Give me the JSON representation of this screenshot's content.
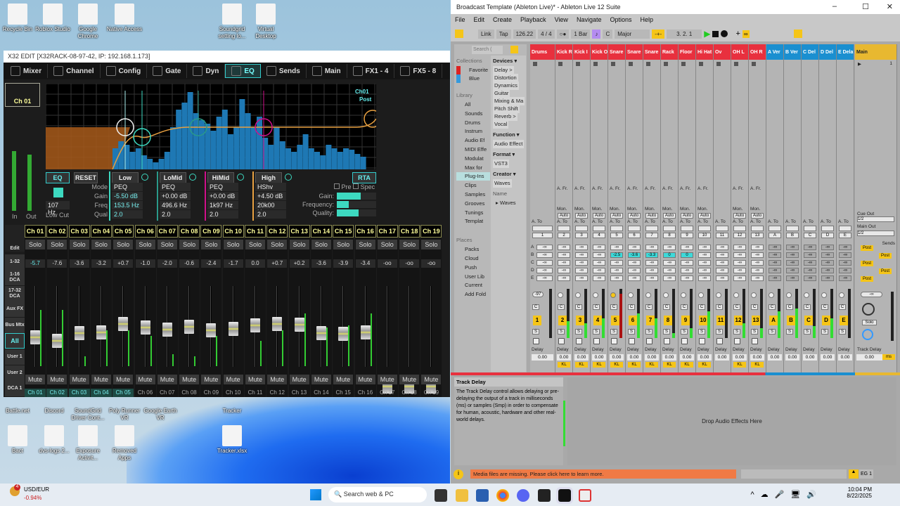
{
  "desktop": {
    "top_icons": [
      {
        "label": "Recycle Bin"
      },
      {
        "label": "Roblox Studio"
      },
      {
        "label": "Google Chrome"
      },
      {
        "label": "Native Access"
      },
      {
        "label": "Soundgrid setting lo..."
      },
      {
        "label": "Virtual Desktop"
      }
    ],
    "row2_icons": [
      {
        "label": "Battle.net"
      },
      {
        "label": "Discord"
      },
      {
        "label": "SoundGrid Driver Cont..."
      },
      {
        "label": "Poly Runner VR"
      },
      {
        "label": "Google Earth VR"
      },
      {
        "label": "Tracker"
      }
    ],
    "row3_icons": [
      {
        "label": "Bact"
      },
      {
        "label": "dvs-logs 2..."
      },
      {
        "label": "Exposure Activit..."
      },
      {
        "label": "Removed Apps"
      },
      {
        "label": "Tracker.xlsx"
      }
    ]
  },
  "x32": {
    "title": "X32 EDIT [X32RACK-08-97-42, IP: 192.168.1.173]",
    "tabs": [
      "Mixer",
      "Channel",
      "Config",
      "Gate",
      "Dyn",
      "EQ",
      "Sends",
      "Main",
      "FX1 - 4",
      "FX5 - 8"
    ],
    "active_tab": "EQ",
    "channel": "Ch 01",
    "meter_labels": {
      "in": "In",
      "out": "Out"
    },
    "graph_labels": {
      "ch": "Ch01",
      "post": "Post"
    },
    "eq_button": "EQ",
    "reset_button": "RESET",
    "rta_button": "RTA",
    "low_cut": {
      "freq": "107 Hz",
      "label": "Low Cut"
    },
    "row_labels": [
      "Mode",
      "Gain",
      "Freq",
      "Qual"
    ],
    "bands": [
      {
        "name": "Low",
        "mode": "PEQ",
        "gain": "-5.50 dB",
        "freq": "153.5 Hz",
        "q": "2.0",
        "color": "#3dd9c0"
      },
      {
        "name": "LoMid",
        "mode": "PEQ",
        "gain": "+0.00 dB",
        "freq": "496.6 Hz",
        "q": "2.0",
        "color": "#2a9a8a"
      },
      {
        "name": "HiMid",
        "mode": "PEQ",
        "gain": "+0.00 dB",
        "freq": "1k97 Hz",
        "q": "2.0",
        "color": "#d0108a"
      },
      {
        "name": "High",
        "mode": "HShv",
        "gain": "+4.50 dB",
        "freq": "20k00 Hz",
        "q": "2.0",
        "color": "#e8a040"
      }
    ],
    "rta": {
      "pre": "Pre",
      "spec": "Spec",
      "gain_label": "Gain:",
      "freq_label": "Frequency:",
      "q_label": "Quality:",
      "gain": 0.6,
      "freq": 0.3,
      "q": 0.55
    },
    "nav": [
      "Edit",
      "1-32",
      "1-16 DCA",
      "17-32 DCA",
      "Aux FX",
      "Bus Mtx",
      "All",
      "User 1",
      "User 2",
      "DCA 1"
    ],
    "solo_label": "Solo",
    "mute_label": "Mute",
    "channels": [
      {
        "name": "Ch 01",
        "value": "-5.7",
        "db": -5.7,
        "meter": 0.55
      },
      {
        "name": "Ch 02",
        "value": "-7.6",
        "db": -7.6,
        "meter": 0.55
      },
      {
        "name": "Ch 03",
        "value": "-3.6",
        "db": -3.6,
        "meter": 0.1
      },
      {
        "name": "Ch 04",
        "value": "-3.2",
        "db": -3.2,
        "meter": 0.35
      },
      {
        "name": "Ch 05",
        "value": "+0.7",
        "db": 0.7,
        "meter": 0.35
      },
      {
        "name": "Ch 06",
        "value": "-1.0",
        "db": -1.0,
        "meter": 0.3
      },
      {
        "name": "Ch 07",
        "value": "-2.0",
        "db": -2.0,
        "meter": 0.12
      },
      {
        "name": "Ch 08",
        "value": "-0.6",
        "db": -0.6,
        "meter": 0.1
      },
      {
        "name": "Ch 09",
        "value": "-2.4",
        "db": -2.4,
        "meter": 0.3
      },
      {
        "name": "Ch 10",
        "value": "-1.7",
        "db": -1.7,
        "meter": 0
      },
      {
        "name": "Ch 11",
        "value": "0.0",
        "db": 0,
        "meter": 0.25
      },
      {
        "name": "Ch 12",
        "value": "+0.7",
        "db": 0.7,
        "meter": 0.35
      },
      {
        "name": "Ch 13",
        "value": "+0.2",
        "db": 0.2,
        "meter": 0.52
      },
      {
        "name": "Ch 14",
        "value": "-3.6",
        "db": -3.6,
        "meter": 0.38
      },
      {
        "name": "Ch 15",
        "value": "-3.9",
        "db": -3.9,
        "meter": 0.4
      },
      {
        "name": "Ch 16",
        "value": "-3.4",
        "db": -3.4,
        "meter": 0.52
      },
      {
        "name": "Ch 17",
        "value": "-oo",
        "db": -90,
        "meter": 0
      },
      {
        "name": "Ch 18",
        "value": "-oo",
        "db": -90,
        "meter": 0
      },
      {
        "name": "Ch 19",
        "value": "-oo",
        "db": -90,
        "meter": 0
      }
    ]
  },
  "ableton": {
    "title": "Broadcast Template (Ableton Live)* - Ableton Live 12 Suite",
    "menu": [
      "File",
      "Edit",
      "Create",
      "Playback",
      "View",
      "Navigate",
      "Options",
      "Help"
    ],
    "toolbar": {
      "link": "Link",
      "tap": "Tap",
      "tempo": "126.22",
      "signature": "4 / 4",
      "quantize": "1 Bar",
      "key": "C",
      "scale": "Major",
      "position": "3.  2.  1"
    },
    "browser": {
      "search_placeholder": "Search (",
      "collections_title": "Collections",
      "collections": [
        "Favorite",
        "Blue"
      ],
      "library_title": "Library",
      "library": [
        "All",
        "Sounds",
        "Drums",
        "Instrum",
        "Audio Ef",
        "MIDI Effe",
        "Modulat",
        "Max for",
        "Plug-Ins",
        "Clips",
        "Samples",
        "Grooves",
        "Tunings",
        "Templat"
      ],
      "places_title": "Places",
      "places": [
        "Packs",
        "Cloud",
        "Push",
        "User Lib",
        "Current",
        "Add Fold"
      ],
      "filters": [
        {
          "title": "Devices ▾",
          "items": [
            "Delay >",
            "Distortion",
            "Dynamics",
            "Guitar",
            "Mixing & Ma",
            "Pitch Shift",
            "Reverb >",
            "Vocal"
          ]
        },
        {
          "title": "Function ▾",
          "items": [
            "Audio Effect"
          ]
        },
        {
          "title": "Format ▾",
          "items": [
            "VST3"
          ]
        },
        {
          "title": "Creator ▾",
          "items": [
            "Waves"
          ]
        }
      ],
      "name_header": "Name",
      "tree_item": "▸ Waves"
    },
    "labels": {
      "a_from": "A. Fr.",
      "monitor": "Mon.",
      "a_to": "A. To",
      "auto": "Auto",
      "delay": "Delay",
      "kl": "KL",
      "c": "C",
      "s": "S",
      "cue_out": "Cue Out",
      "cue_val": "1/2",
      "main_out": "Main Out",
      "main_val": "1/2",
      "sends": "Sends",
      "post": "Post",
      "track_delay": "Track Delay",
      "ms": "ms",
      "solo": "Solo",
      "neg_inf": "-∞",
      "main_clip": "1",
      "send_letters": [
        "A",
        "B",
        "C",
        "D",
        "E"
      ],
      "first_vol": "-97"
    },
    "tracks": [
      {
        "name": "Drums",
        "num": "1",
        "color": "#e8303e",
        "sendB": "-∞",
        "delay": "0.00",
        "kl": false,
        "meter": 0
      },
      {
        "name": "Kick R",
        "num": "2",
        "color": "#e8303e",
        "sendB": "-∞",
        "delay": "0.00",
        "kl": true,
        "meter": 0.35
      },
      {
        "name": "Kick I",
        "num": "3",
        "color": "#e8303e",
        "sendB": "-∞",
        "delay": "0.00",
        "kl": true,
        "meter": 0.3
      },
      {
        "name": "Kick O",
        "num": "4",
        "color": "#e8303e",
        "sendB": "-∞",
        "delay": "0.00",
        "kl": true,
        "meter": 0.4
      },
      {
        "name": "Snare",
        "num": "5",
        "color": "#e8303e",
        "sendB": "-2.5",
        "delay": "0.00",
        "kl": true,
        "meter": 0.9,
        "red": true
      },
      {
        "name": "Snare",
        "num": "6",
        "color": "#e8303e",
        "sendB": "-3.6",
        "delay": "0.00",
        "kl": true,
        "meter": 0.5
      },
      {
        "name": "Snare",
        "num": "7",
        "color": "#e8303e",
        "sendB": "-3.3",
        "delay": "0.00",
        "kl": true,
        "meter": 0.4
      },
      {
        "name": "Rack",
        "num": "8",
        "color": "#e8303e",
        "sendB": "0",
        "delay": "0.00",
        "kl": true,
        "meter": 0.1
      },
      {
        "name": "Floor",
        "num": "9",
        "color": "#e8303e",
        "sendB": "0",
        "delay": "0.00",
        "kl": true,
        "meter": 0.2
      },
      {
        "name": "Hi Hat",
        "num": "10",
        "color": "#e8303e",
        "sendB": "-∞",
        "delay": "0.00",
        "kl": true,
        "meter": 0.55
      },
      {
        "name": "Ov",
        "num": "11",
        "color": "#e8303e",
        "sendB": "-∞",
        "delay": "0.00",
        "kl": false,
        "meter": 0
      },
      {
        "name": "OH L",
        "num": "12",
        "color": "#e8303e",
        "sendB": "-∞",
        "delay": "0.00",
        "kl": true,
        "meter": 0.3
      },
      {
        "name": "OH R",
        "num": "13",
        "color": "#e8303e",
        "sendB": "-∞",
        "delay": "0.00",
        "kl": true,
        "meter": 0.2
      },
      {
        "name": "A Ver",
        "num": "A",
        "color": "#1a8fd0",
        "sendB": "-∞",
        "delay": "0.00",
        "kl": false,
        "meter": 0.55
      },
      {
        "name": "B Ver",
        "num": "B",
        "color": "#1a8fd0",
        "sendB": "-∞",
        "delay": "0.00",
        "kl": false,
        "meter": 0.6
      },
      {
        "name": "C Del",
        "num": "C",
        "color": "#1a8fd0",
        "sendB": "-∞",
        "delay": "0.00",
        "kl": false,
        "meter": 0.25
      },
      {
        "name": "D Del",
        "num": "D",
        "color": "#1a8fd0",
        "sendB": "-∞",
        "delay": "0.00",
        "kl": false,
        "meter": 0.4
      },
      {
        "name": "E Dela",
        "num": "E",
        "color": "#1a8fd0",
        "sendB": "-∞",
        "delay": "0.00",
        "kl": false,
        "meter": 0
      }
    ],
    "main": {
      "name": "Main",
      "color": "#e8b830",
      "delay": "0.00"
    },
    "info": {
      "title": "Track Delay",
      "text": "The Track Delay control allows delaying or pre-delaying the output of a track in milliseconds (ms) or samples (Smp) in order to compensate for human, acoustic, hardware and other real-world delays."
    },
    "drop_text": "Drop Audio Effects Here",
    "status": "Media files are missing. Please click here to learn more.",
    "eg": "EG 1"
  },
  "taskbar": {
    "widget_title": "USD/EUR",
    "widget_value": "-0.94%",
    "badge": "4",
    "search": "Search web & PC",
    "time": "10:04 PM",
    "date": "8/22/2025"
  }
}
